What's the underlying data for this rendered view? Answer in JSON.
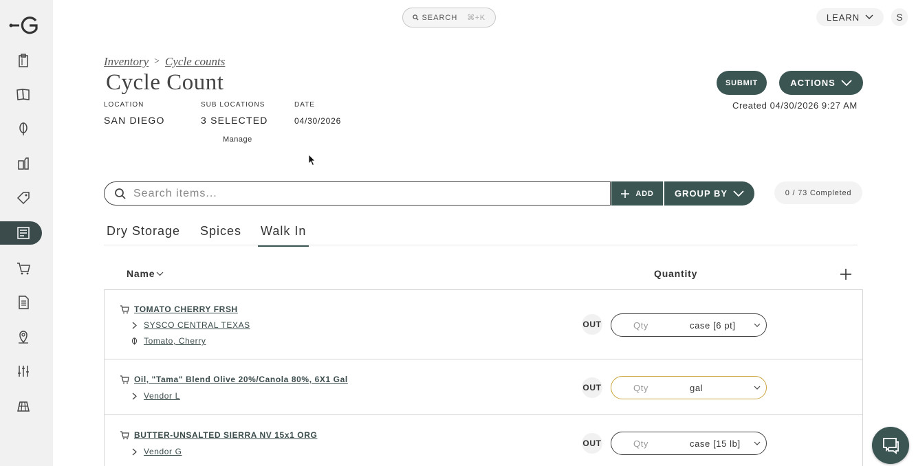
{
  "topbar": {
    "search_label": "SEARCH",
    "search_shortcut": "⌘+K",
    "learn_label": "LEARN",
    "avatar_initial": "S"
  },
  "sidebar": {
    "items": [
      {
        "icon": "clipboard-icon"
      },
      {
        "icon": "book-icon"
      },
      {
        "icon": "produce-icon"
      },
      {
        "icon": "cans-icon"
      },
      {
        "icon": "tag-icon"
      },
      {
        "icon": "cycle-count-icon",
        "active": true
      },
      {
        "icon": "cart-icon"
      },
      {
        "icon": "document-icon"
      },
      {
        "icon": "location-pin-icon"
      },
      {
        "icon": "sliders-icon"
      },
      {
        "icon": "reports-icon"
      }
    ]
  },
  "breadcrumb": {
    "first": "Inventory",
    "separator": ">",
    "second": "Cycle counts"
  },
  "page_title": "Cycle Count",
  "meta": {
    "location_label": "LOCATION",
    "location_value": "SAN DIEGO",
    "sublocations_label": "SUB LOCATIONS",
    "sublocations_value": "3 SELECTED",
    "manage_label": "Manage",
    "date_label": "DATE",
    "date_value": "04/30/2026"
  },
  "actions": {
    "submit_label": "SUBMIT",
    "actions_label": "ACTIONS",
    "created_text": "Created 04/30/2026 9:27 AM"
  },
  "toolbar": {
    "search_placeholder": "Search items...",
    "add_label": "ADD",
    "group_by_label": "GROUP BY",
    "completed_text": "0 / 73 Completed"
  },
  "tabs": [
    {
      "label": "Dry Storage",
      "active": false
    },
    {
      "label": "Spices",
      "active": false
    },
    {
      "label": "Walk In",
      "active": true
    }
  ],
  "table": {
    "col_name": "Name",
    "col_quantity": "Quantity",
    "rows": [
      {
        "name": "TOMATO CHERRY FRSH",
        "vendor": "SYSCO CENTRAL TEXAS",
        "ingredient": "Tomato, Cherry",
        "status": "OUT",
        "qty_placeholder": "Qty",
        "unit": "case [6 pt]"
      },
      {
        "name": "Oil, \"Tama\" Blend Olive 20%/Canola 80%, 6X1 Gal",
        "vendor": "Vendor L",
        "status": "OUT",
        "qty_placeholder": "Qty",
        "unit": "gal"
      },
      {
        "name": "BUTTER-UNSALTED SIERRA NV 15x1 ORG",
        "vendor": "Vendor G",
        "status": "OUT",
        "qty_placeholder": "Qty",
        "unit": "case [15 lb]"
      }
    ]
  },
  "colors": {
    "primary": "#3b5553",
    "sidebar_bg": "#f1f1f1",
    "focus_border": "#c9a33a"
  }
}
